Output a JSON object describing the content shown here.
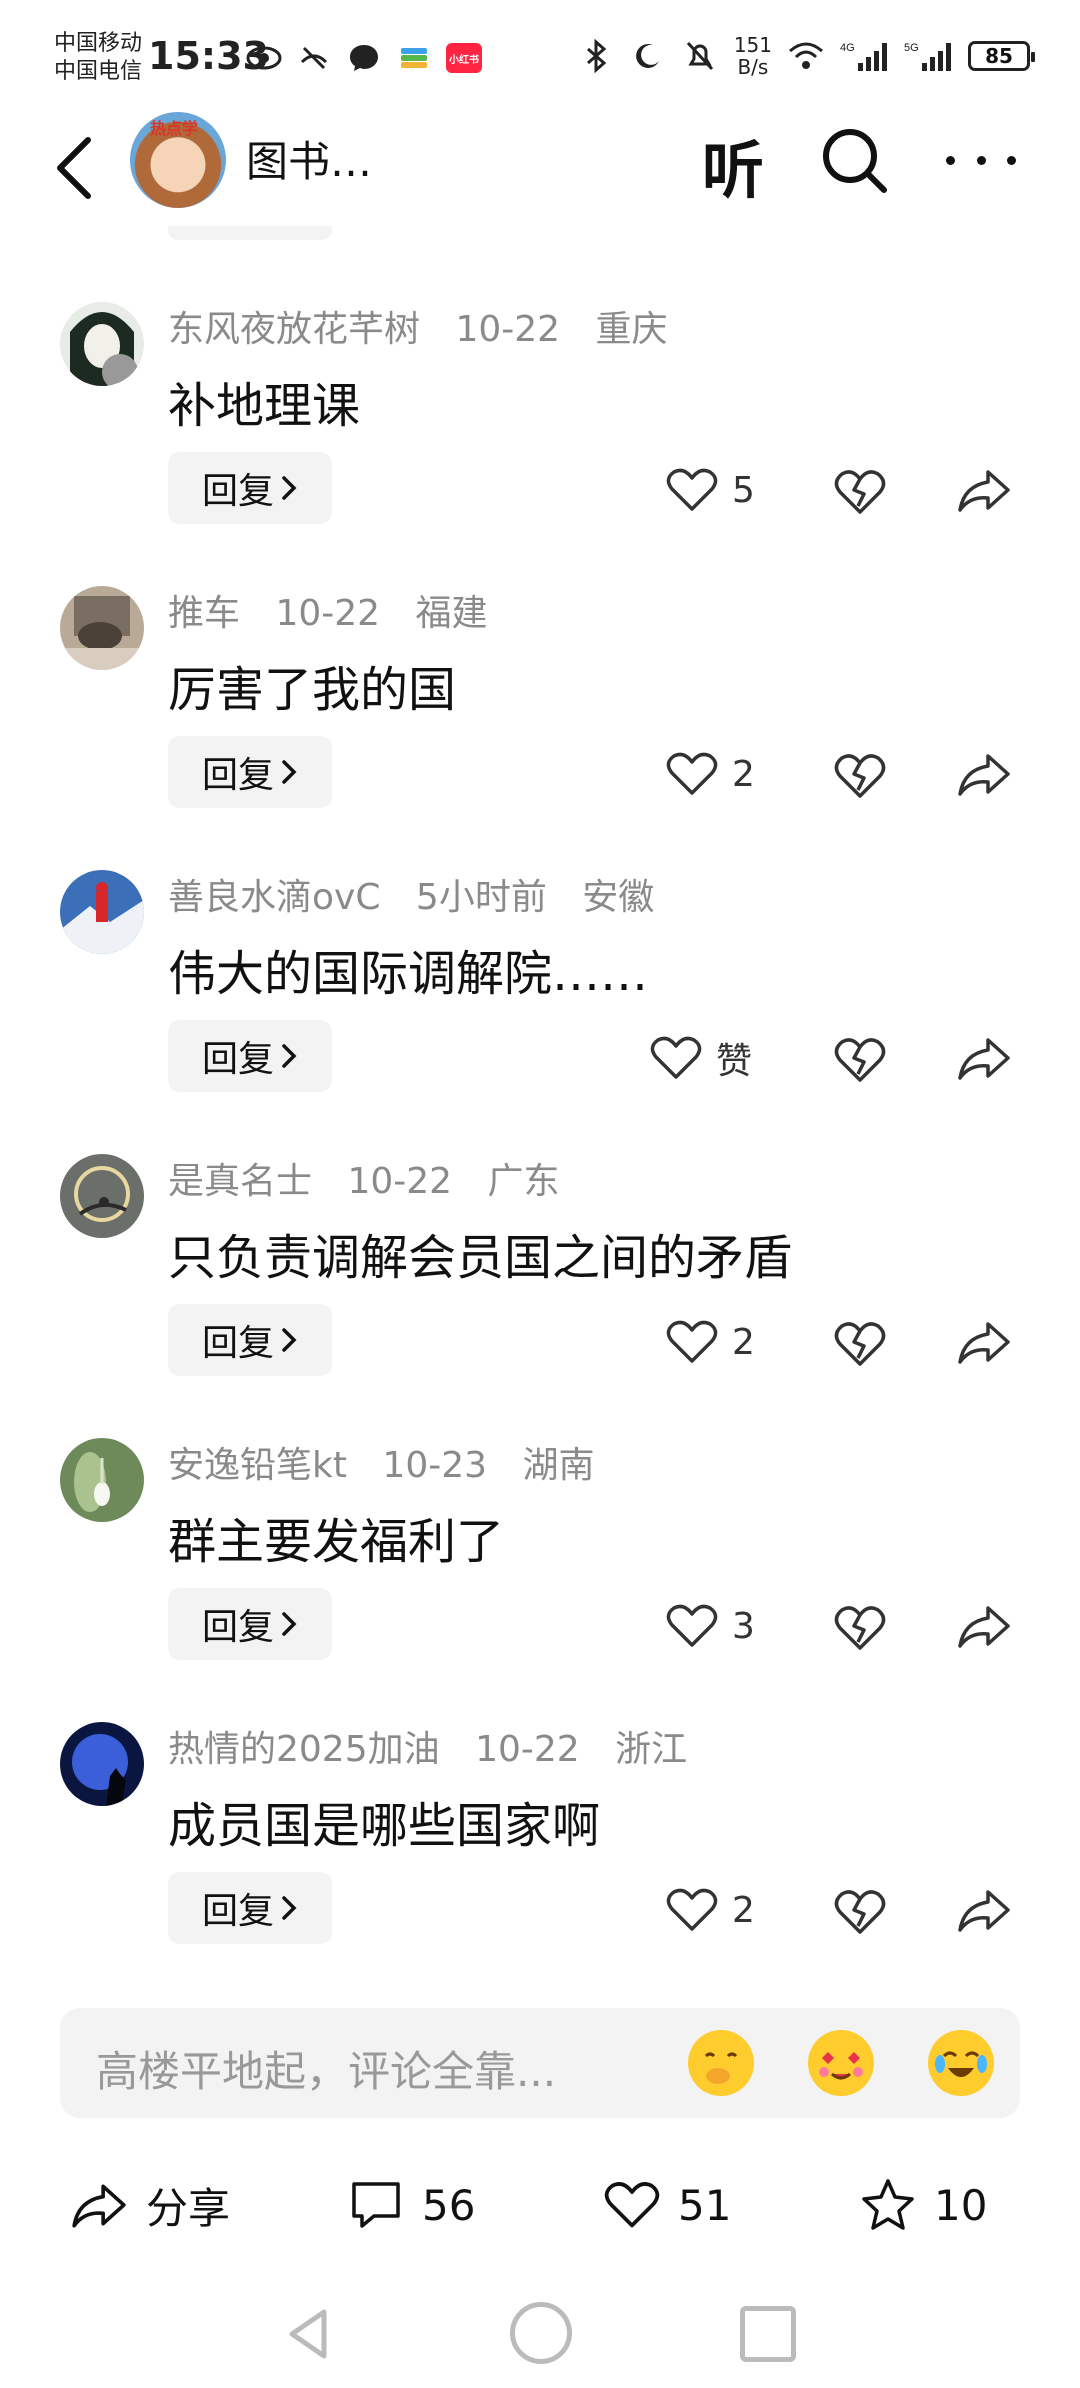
{
  "status_bar": {
    "carrier_1": "中国移动",
    "carrier_2": "中国电信",
    "time": "15:33",
    "app_badge": "小红书",
    "net_speed_value": "151",
    "net_speed_unit": "B/s",
    "signal_1": "4G",
    "signal_2": "5G",
    "battery": "85"
  },
  "header": {
    "avatar_text": "热点学",
    "title": "图书…",
    "listen_label": "听"
  },
  "comments": [
    {
      "user": "东风夜放花芊树",
      "date": "10-22",
      "location": "重庆",
      "text": "补地理课",
      "reply": "回复",
      "likes": "5"
    },
    {
      "user": "推车",
      "date": "10-22",
      "location": "福建",
      "text": "厉害了我的国",
      "reply": "回复",
      "likes": "2"
    },
    {
      "user": "善良水滴ovC",
      "date": "5小时前",
      "location": "安徽",
      "text": "伟大的国际调解院……",
      "reply": "回复",
      "likes": "赞"
    },
    {
      "user": "是真名士",
      "date": "10-22",
      "location": "广东",
      "text": "只负责调解会员国之间的矛盾",
      "reply": "回复",
      "likes": "2"
    },
    {
      "user": "安逸铅笔kt",
      "date": "10-23",
      "location": "湖南",
      "text": "群主要发福利了",
      "reply": "回复",
      "likes": "3"
    },
    {
      "user": "热情的2025加油",
      "date": "10-22",
      "location": "浙江",
      "text": "成员国是哪些国家啊",
      "reply": "回复",
      "likes": "2"
    }
  ],
  "comment_input": {
    "placeholder": "高楼平地起，评论全靠..."
  },
  "bottom_actions": {
    "share_label": "分享",
    "comments_count": "56",
    "likes_count": "51",
    "favorites_count": "10"
  },
  "colors": {
    "meta_gray": "#8a8a8a",
    "reply_bg": "#f3f3f3",
    "brand_red": "#ff2442"
  }
}
